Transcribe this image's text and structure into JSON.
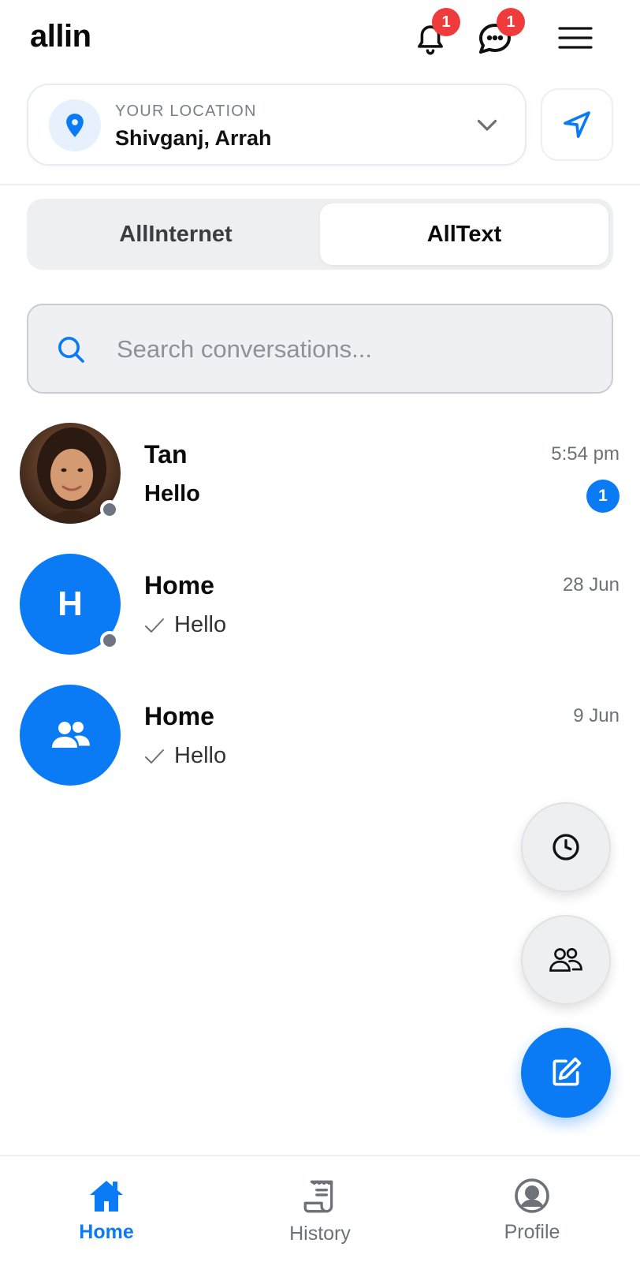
{
  "header": {
    "app_title": "allin",
    "notifications_badge": "1",
    "messages_badge": "1"
  },
  "location": {
    "label": "YOUR LOCATION",
    "value": "Shivganj, Arrah"
  },
  "tabs": [
    {
      "label": "AllInternet",
      "active": false
    },
    {
      "label": "AllText",
      "active": true
    }
  ],
  "search": {
    "placeholder": "Search conversations..."
  },
  "conversations": [
    {
      "name": "Tan",
      "message": "Hello",
      "time": "5:54 pm",
      "unread": "1",
      "avatar_type": "photo",
      "read": false
    },
    {
      "name": "Home",
      "message": "Hello",
      "time": "28 Jun",
      "avatar_type": "initial",
      "initial": "H",
      "read": true
    },
    {
      "name": "Home",
      "message": "Hello",
      "time": "9 Jun",
      "avatar_type": "group-icon",
      "read": true
    }
  ],
  "fabs": [
    "clock-icon",
    "group-icon",
    "compose-icon"
  ],
  "bottom_nav": [
    {
      "label": "Home",
      "icon": "home-icon",
      "active": true
    },
    {
      "label": "History",
      "icon": "receipt-icon",
      "active": false
    },
    {
      "label": "Profile",
      "icon": "profile-icon",
      "active": false
    }
  ],
  "colors": {
    "accent": "#0b7bf5",
    "badge": "#ef3b3b",
    "muted": "#6d7178"
  }
}
